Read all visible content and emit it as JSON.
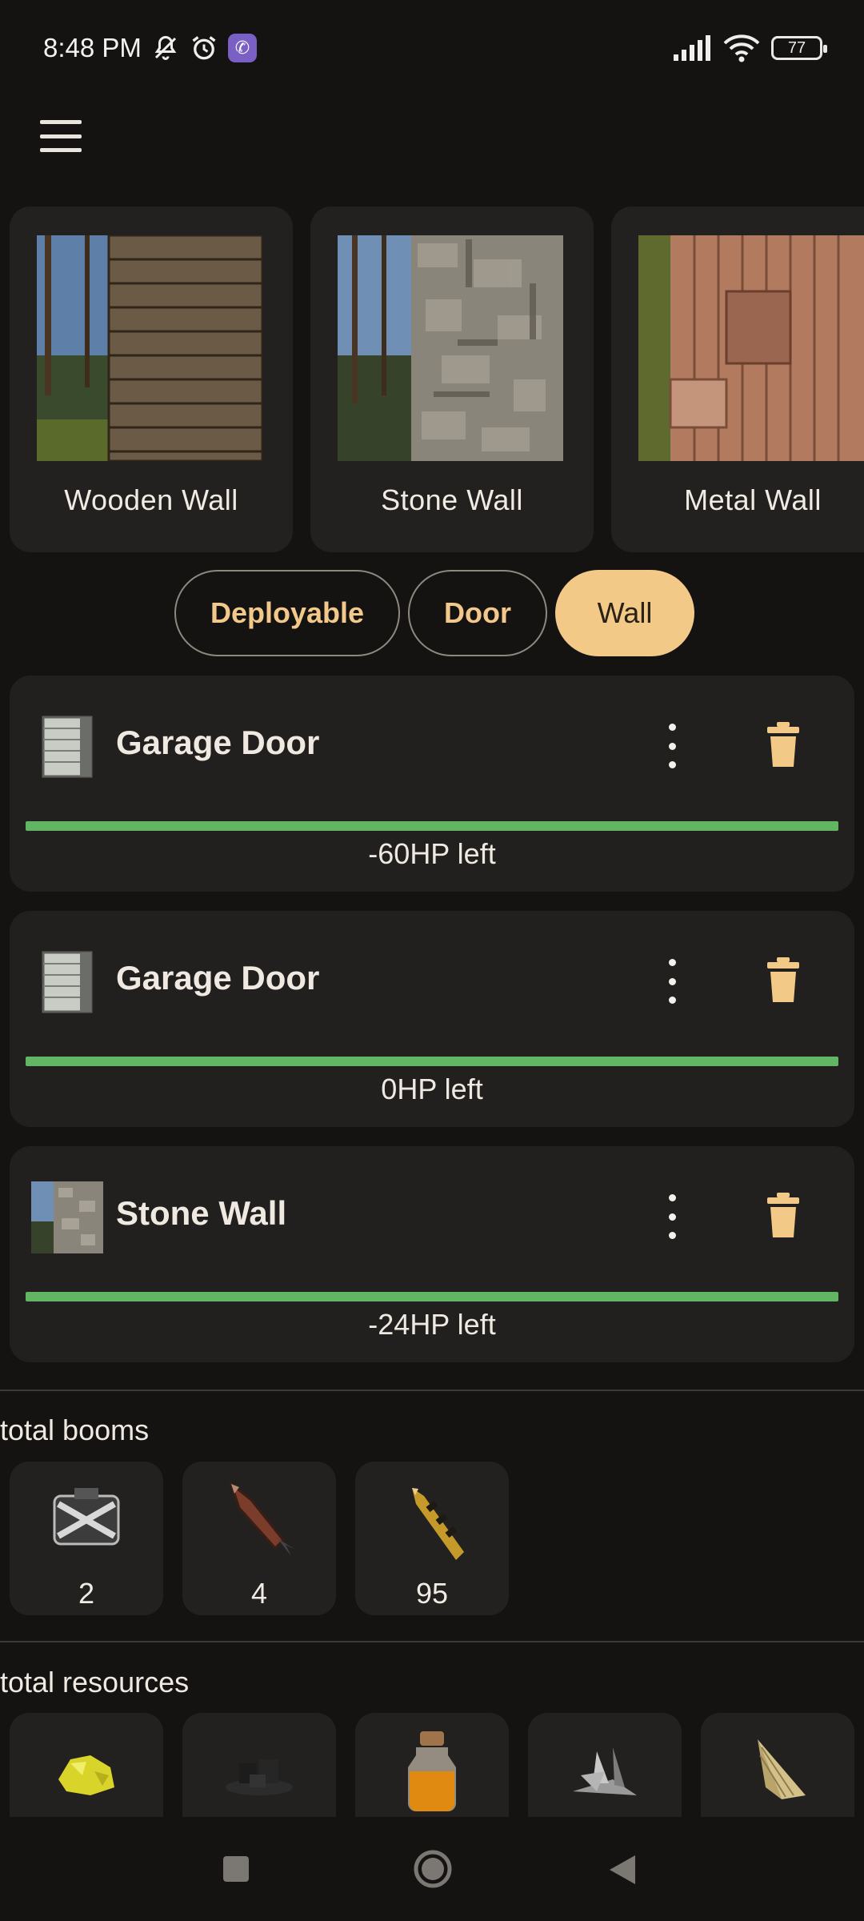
{
  "status_bar": {
    "time": "8:48 PM",
    "icons": [
      "mute-icon",
      "alarm-icon",
      "viber-icon",
      "signal-icon",
      "wifi-icon",
      "battery-icon"
    ],
    "battery_level": "77"
  },
  "app_bar": {
    "menu_icon": "hamburger-menu-icon"
  },
  "wall_cards": [
    {
      "label": "Wooden Wall"
    },
    {
      "label": "Stone Wall"
    },
    {
      "label": "Metal Wall"
    }
  ],
  "filters": [
    {
      "label": "Deployable",
      "selected": false
    },
    {
      "label": "Door",
      "selected": false
    },
    {
      "label": "Wall",
      "selected": true
    }
  ],
  "items": [
    {
      "name": "Garage Door",
      "hp_text": "-60HP left",
      "progress": 1.0
    },
    {
      "name": "Garage Door",
      "hp_text": "0HP left",
      "progress": 1.0
    },
    {
      "name": "Stone Wall",
      "hp_text": "-24HP left",
      "progress": 1.0
    }
  ],
  "booms": {
    "title": "total booms",
    "tiles": [
      {
        "icon": "c4-icon",
        "count": "2"
      },
      {
        "icon": "rocket-icon",
        "count": "4"
      },
      {
        "icon": "explosive-ammo-icon",
        "count": "95"
      }
    ]
  },
  "resources": {
    "title": "total resources",
    "tiles": [
      {
        "icon": "sulfur-icon"
      },
      {
        "icon": "charcoal-icon"
      },
      {
        "icon": "low-grade-fuel-icon"
      },
      {
        "icon": "metal-fragments-icon"
      },
      {
        "icon": "cloth-icon"
      }
    ]
  },
  "colors": {
    "background": "#141312",
    "card": "#23211f",
    "accent": "#f3c987",
    "progress": "#62b562"
  }
}
